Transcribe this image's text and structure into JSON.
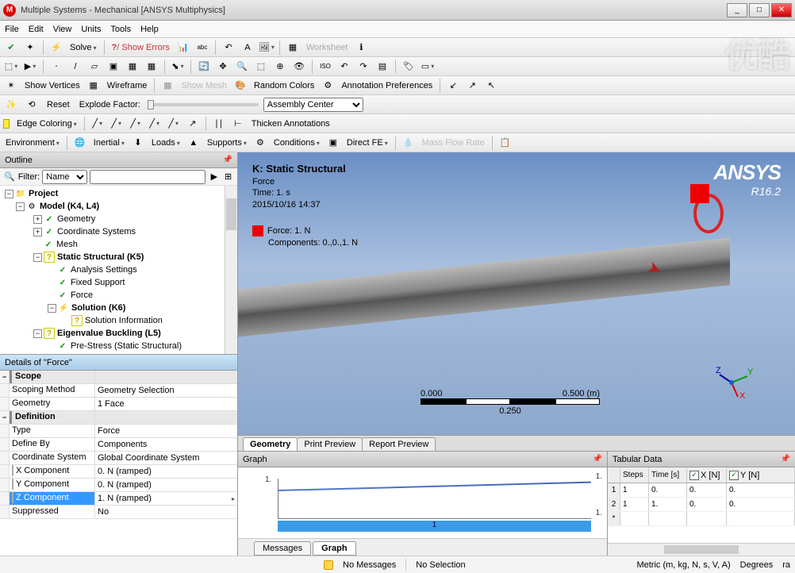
{
  "title": "Multiple Systems - Mechanical [ANSYS Multiphysics]",
  "menus": [
    "File",
    "Edit",
    "View",
    "Units",
    "Tools",
    "Help"
  ],
  "watermark": "优酷",
  "tb1": {
    "solve": "Solve",
    "showerrors": "Show Errors",
    "worksheet": "Worksheet"
  },
  "tb_show": {
    "show_vertices": "Show Vertices",
    "wireframe": "Wireframe",
    "show_mesh": "Show Mesh",
    "random_colors": "Random Colors",
    "annot_prefs": "Annotation Preferences"
  },
  "explode": {
    "reset": "Reset",
    "label": "Explode Factor:",
    "assembly": "Assembly Center"
  },
  "edge": {
    "coloring": "Edge Coloring",
    "thicken": "Thicken Annotations"
  },
  "env": {
    "environment": "Environment",
    "inertial": "Inertial",
    "loads": "Loads",
    "supports": "Supports",
    "conditions": "Conditions",
    "directfe": "Direct FE",
    "massflow": "Mass Flow Rate"
  },
  "outline": {
    "title": "Outline",
    "filter_label": "Filter:",
    "filter_opt": "Name",
    "items": {
      "project": "Project",
      "model": "Model (K4, L4)",
      "geometry": "Geometry",
      "coords": "Coordinate Systems",
      "mesh": "Mesh",
      "static": "Static Structural (K5)",
      "analysis": "Analysis Settings",
      "fixed": "Fixed Support",
      "force": "Force",
      "solution": "Solution (K6)",
      "solinfo": "Solution Information",
      "eigen": "Eigenvalue Buckling (L5)",
      "prestress": "Pre-Stress (Static Structural)"
    }
  },
  "details": {
    "title": "Details of \"Force\"",
    "scope": "Scope",
    "scoping_method_k": "Scoping Method",
    "scoping_method_v": "Geometry Selection",
    "geometry_k": "Geometry",
    "geometry_v": "1 Face",
    "definition": "Definition",
    "type_k": "Type",
    "type_v": "Force",
    "defineby_k": "Define By",
    "defineby_v": "Components",
    "cs_k": "Coordinate System",
    "cs_v": "Global Coordinate System",
    "xc_k": "X Component",
    "xc_v": "0. N  (ramped)",
    "yc_k": "Y Component",
    "yc_v": "0. N  (ramped)",
    "zc_k": "Z Component",
    "zc_v": "1. N  (ramped)",
    "supp_k": "Suppressed",
    "supp_v": "No"
  },
  "viewport": {
    "heading": "K: Static Structural",
    "sub1": "Force",
    "sub2": "Time: 1. s",
    "sub3": "2015/10/16 14:37",
    "force_label": "Force: 1. N",
    "comp_label": "Components: 0.,0.,1. N",
    "ansys": "ANSYS",
    "ver": "R16.2",
    "scale_left": "0.000",
    "scale_right": "0.500 (m)",
    "scale_mid": "0.250",
    "tabs": {
      "geometry": "Geometry",
      "print": "Print Preview",
      "report": "Report Preview"
    }
  },
  "graph": {
    "title": "Graph",
    "y_top": "1.",
    "y_right_top": "1.",
    "y_right_bot": "1.",
    "bar_num": "1",
    "tabs": {
      "messages": "Messages",
      "graph": "Graph"
    }
  },
  "tabular": {
    "title": "Tabular Data",
    "cols": {
      "steps": "Steps",
      "time": "Time [s]",
      "x": "X [N]",
      "y": "Y [N]"
    },
    "rows": [
      {
        "n": "1",
        "steps": "1",
        "time": "0.",
        "x": "0.",
        "y": "0."
      },
      {
        "n": "2",
        "steps": "1",
        "time": "1.",
        "x": "0.",
        "y": "0."
      }
    ],
    "star": "*"
  },
  "status": {
    "nomsg": "No Messages",
    "nosel": "No Selection",
    "units": "Metric (m, kg, N, s, V, A)",
    "degrees": "Degrees",
    "rad": "ra"
  }
}
